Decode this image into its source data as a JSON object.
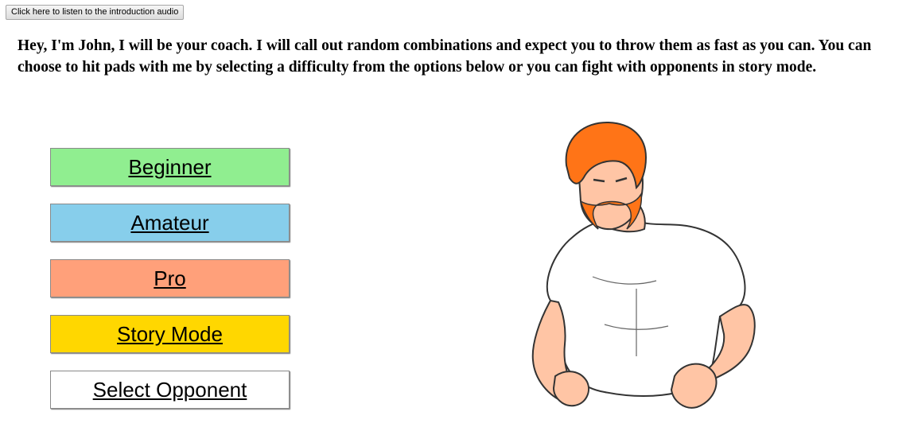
{
  "audio_button": {
    "label": "Click here to listen to the introduction audio"
  },
  "intro_text": "Hey, I'm John, I will be your coach. I will call out random combinations and expect you to throw them as fast as you can. You can choose to hit pads with me by selecting a difficulty from the options below or you can fight with opponents in story mode.",
  "menu": {
    "beginner": {
      "label": "Beginner",
      "color": "#90ee90"
    },
    "amateur": {
      "label": "Amateur",
      "color": "#87ceeb"
    },
    "pro": {
      "label": "Pro",
      "color": "#ffa07a"
    },
    "story_mode": {
      "label": "Story Mode",
      "color": "#ffd700"
    },
    "select_opponent": {
      "label": "Select Opponent",
      "color": "#ffffff"
    }
  },
  "coach_image": {
    "icon": "coach-john-illustration"
  }
}
